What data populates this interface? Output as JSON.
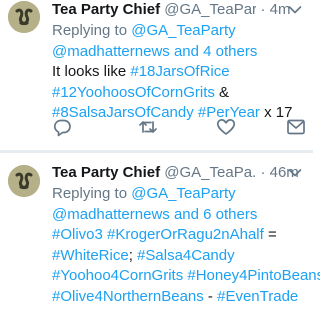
{
  "tweets": [
    {
      "name": "Tea Party Chief",
      "handle": "@GA_TeaPar...",
      "dot": "·",
      "time": "4m",
      "replying_prefix": "Replying to ",
      "replying_handle": "@GA_TeaParty",
      "replying_others": "@madhatternews and 4 others",
      "text": {
        "l1_plain": "It looks like ",
        "l1_tag": "#18JarsOfRice",
        "l2_tag": "#12YoohoosOfCornGrits",
        "l2_plain": " &",
        "l3_tag1": "#8SalsaJarsOfCandy",
        "l3_sp": " ",
        "l3_tag2": "#PerYear",
        "l3_plain": " x 17"
      },
      "icons": [
        "reply-icon",
        "retweet-icon",
        "like-icon",
        "share-icon"
      ]
    },
    {
      "name": "Tea Party Chief",
      "handle": "@GA_TeaPa...",
      "dot": "·",
      "time": "46m",
      "replying_prefix": "Replying to ",
      "replying_handle": "@GA_TeaParty",
      "replying_others": "@madhatternews and 6 others",
      "text": {
        "l1_tag1": "#Olivo3",
        "l1_sp": " ",
        "l1_tag2": "#KrogerOrRagu2nAhalf",
        "l1_plain": " =",
        "l2_tag1": "#WhiteRice",
        "l2_plain": "; ",
        "l2_tag2": "#Salsa4Candy",
        "l3_tag1": "#Yoohoo4CornGrits",
        "l3_sp": " ",
        "l3_tag2": "#Honey4PintoBeans",
        "l4_tag1": "#Olive4NorthernBeans",
        "l4_plain": " - ",
        "l4_tag2": "#EvenTrade"
      }
    }
  ],
  "colors": {
    "link": "#1da1f2",
    "muted": "#657786",
    "text": "#14171a",
    "divider": "#e6ecf0",
    "avatar_bg": "#b6b089"
  }
}
